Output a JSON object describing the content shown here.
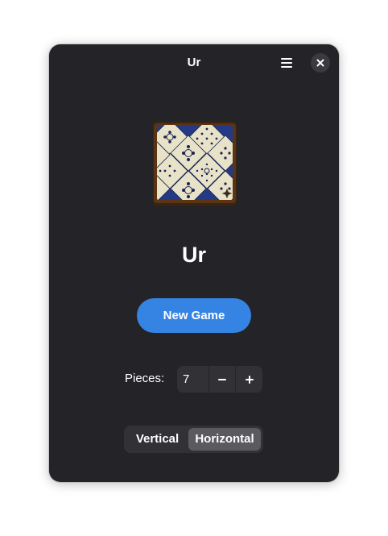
{
  "window": {
    "title": "Ur"
  },
  "header": {
    "menu_icon": "hamburger-menu-icon",
    "close_icon": "close-icon"
  },
  "app": {
    "name": "Ur",
    "logo": "royal-game-of-ur-board-icon"
  },
  "actions": {
    "new_game_label": "New Game"
  },
  "pieces": {
    "label": "Pieces:",
    "value": "7",
    "decrement_icon": "minus-icon",
    "increment_icon": "plus-icon"
  },
  "orientation": {
    "options": [
      "Vertical",
      "Horizontal"
    ],
    "selected": "Horizontal"
  },
  "colors": {
    "window_bg": "#242428",
    "accent": "#3584e4",
    "control_bg": "#323236",
    "selected_toggle_bg": "#5a5a5f",
    "text": "#ffffff"
  }
}
